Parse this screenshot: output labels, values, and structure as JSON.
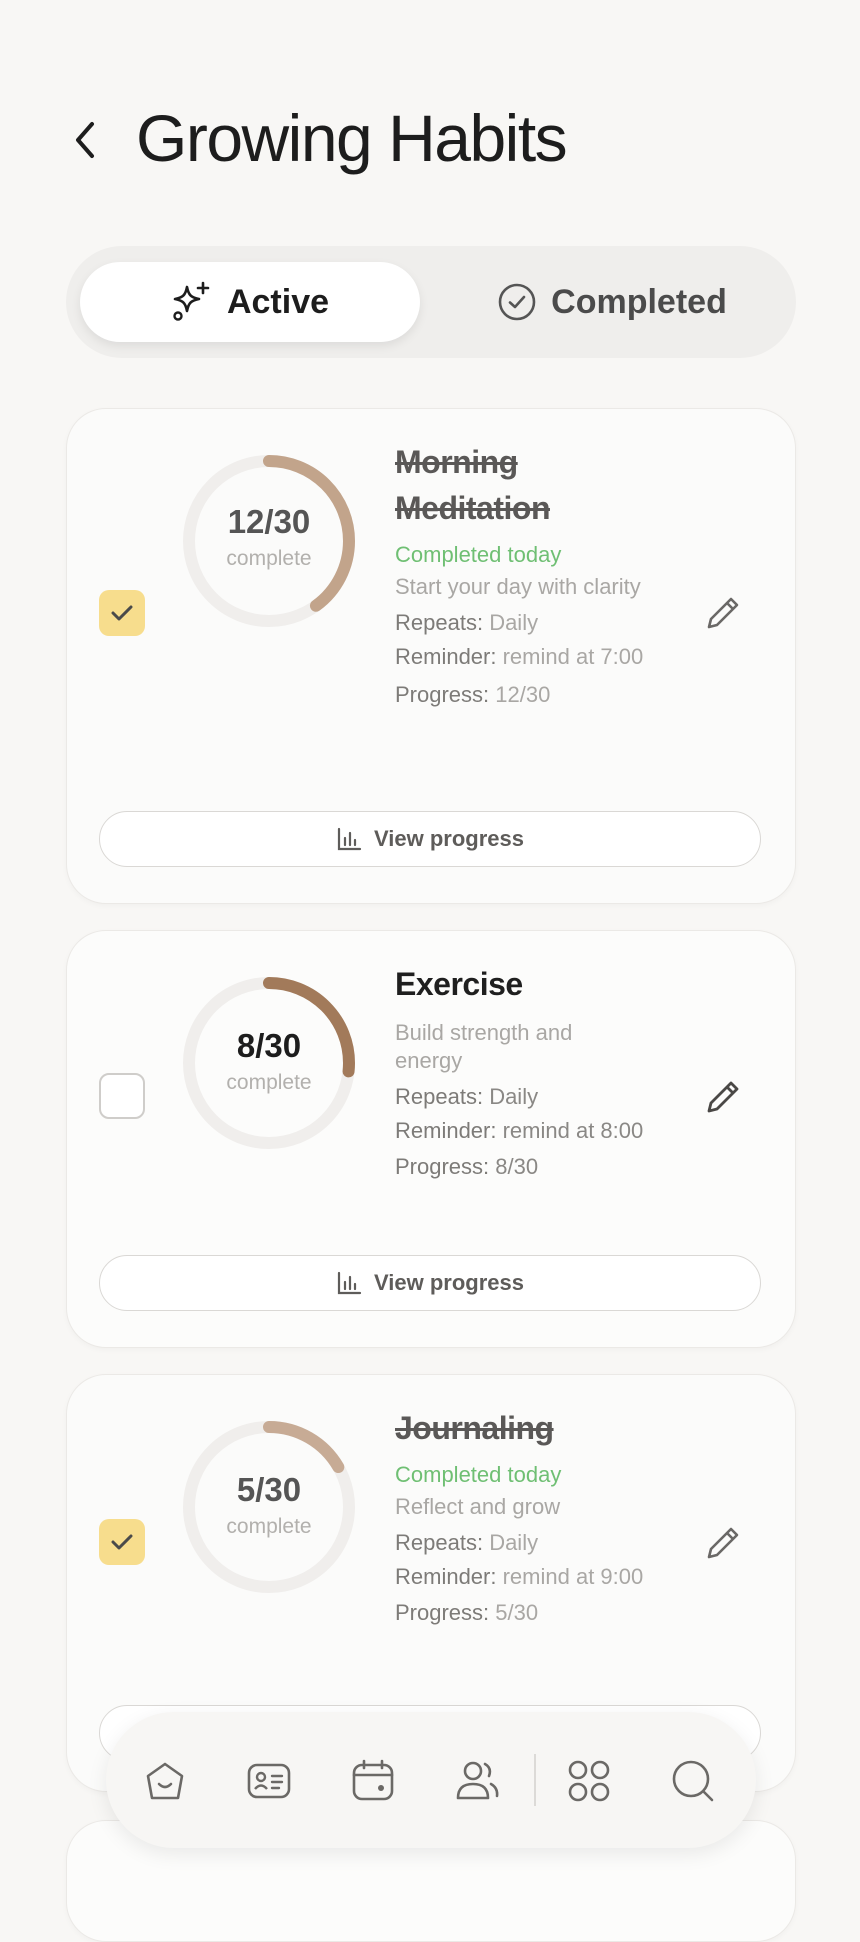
{
  "header": {
    "title": "Growing Habits",
    "back_icon": "chevron-left-icon"
  },
  "tabs": [
    {
      "label": "Active",
      "icon": "sparkles-icon",
      "selected": true
    },
    {
      "label": "Completed",
      "icon": "check-circle-icon",
      "selected": false
    }
  ],
  "labels": {
    "complete": "complete",
    "completed_today": "Completed today",
    "repeats": "Repeats:",
    "reminder": "Reminder:",
    "progress": "Progress:",
    "view_progress": "View progress"
  },
  "habits": [
    {
      "title": "Morning Meditation",
      "done": true,
      "status": "Completed today",
      "description": "Start your day with clarity",
      "repeats": "Daily",
      "reminder": "remind at 7:00",
      "progress": "12/30",
      "current": 12,
      "total": 30,
      "ring_color": "#c2a48b"
    },
    {
      "title": "Exercise",
      "done": false,
      "status": "",
      "description": "Build strength and energy",
      "repeats": "Daily",
      "reminder": "remind at 8:00",
      "progress": "8/30",
      "current": 8,
      "total": 30,
      "ring_color": "#a27a5a"
    },
    {
      "title": "Journaling",
      "done": true,
      "status": "Completed today",
      "description": "Reflect and grow",
      "repeats": "Daily",
      "reminder": "remind at 9:00",
      "progress": "5/30",
      "current": 5,
      "total": 30,
      "ring_color": "#c7ab95"
    }
  ],
  "nav": [
    "home-icon",
    "profile-card-icon",
    "calendar-icon",
    "people-icon",
    "apps-icon",
    "search-icon"
  ],
  "colors": {
    "background": "#f8f7f5",
    "check_on": "#f7dd8d",
    "completed_green": "#6fbf73"
  }
}
